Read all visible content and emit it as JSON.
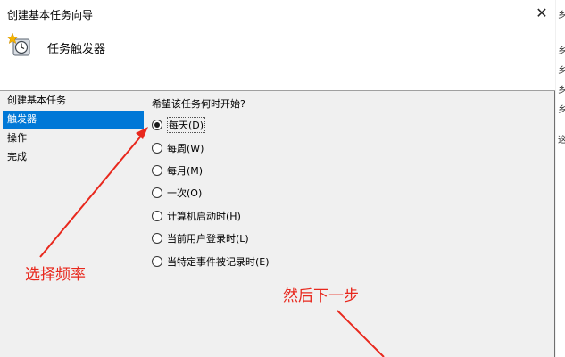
{
  "window": {
    "title": "创建基本任务向导",
    "close_symbol": "✕"
  },
  "header": {
    "title": "任务触发器",
    "icon": "clock-icon"
  },
  "steps": [
    {
      "label": "创建基本任务"
    },
    {
      "label": "触发器"
    },
    {
      "label": "操作"
    },
    {
      "label": "完成"
    }
  ],
  "trigger": {
    "question": "希望该任务何时开始?",
    "options": [
      {
        "label": "每天(D)",
        "checked": true
      },
      {
        "label": "每周(W)",
        "checked": false
      },
      {
        "label": "每月(M)",
        "checked": false
      },
      {
        "label": "一次(O)",
        "checked": false
      },
      {
        "label": "计算机启动时(H)",
        "checked": false
      },
      {
        "label": "当前用户登录时(L)",
        "checked": false
      },
      {
        "label": "当特定事件被记录时(E)",
        "checked": false
      }
    ]
  },
  "annotations": {
    "choose_frequency": "选择频率",
    "then_next": "然后下一步"
  },
  "background_window_glyphs": [
    "乡",
    "乡",
    "乡",
    "乡",
    "乡",
    "这"
  ],
  "colors": {
    "selection": "#0078d7",
    "annotation": "#e8281d"
  }
}
